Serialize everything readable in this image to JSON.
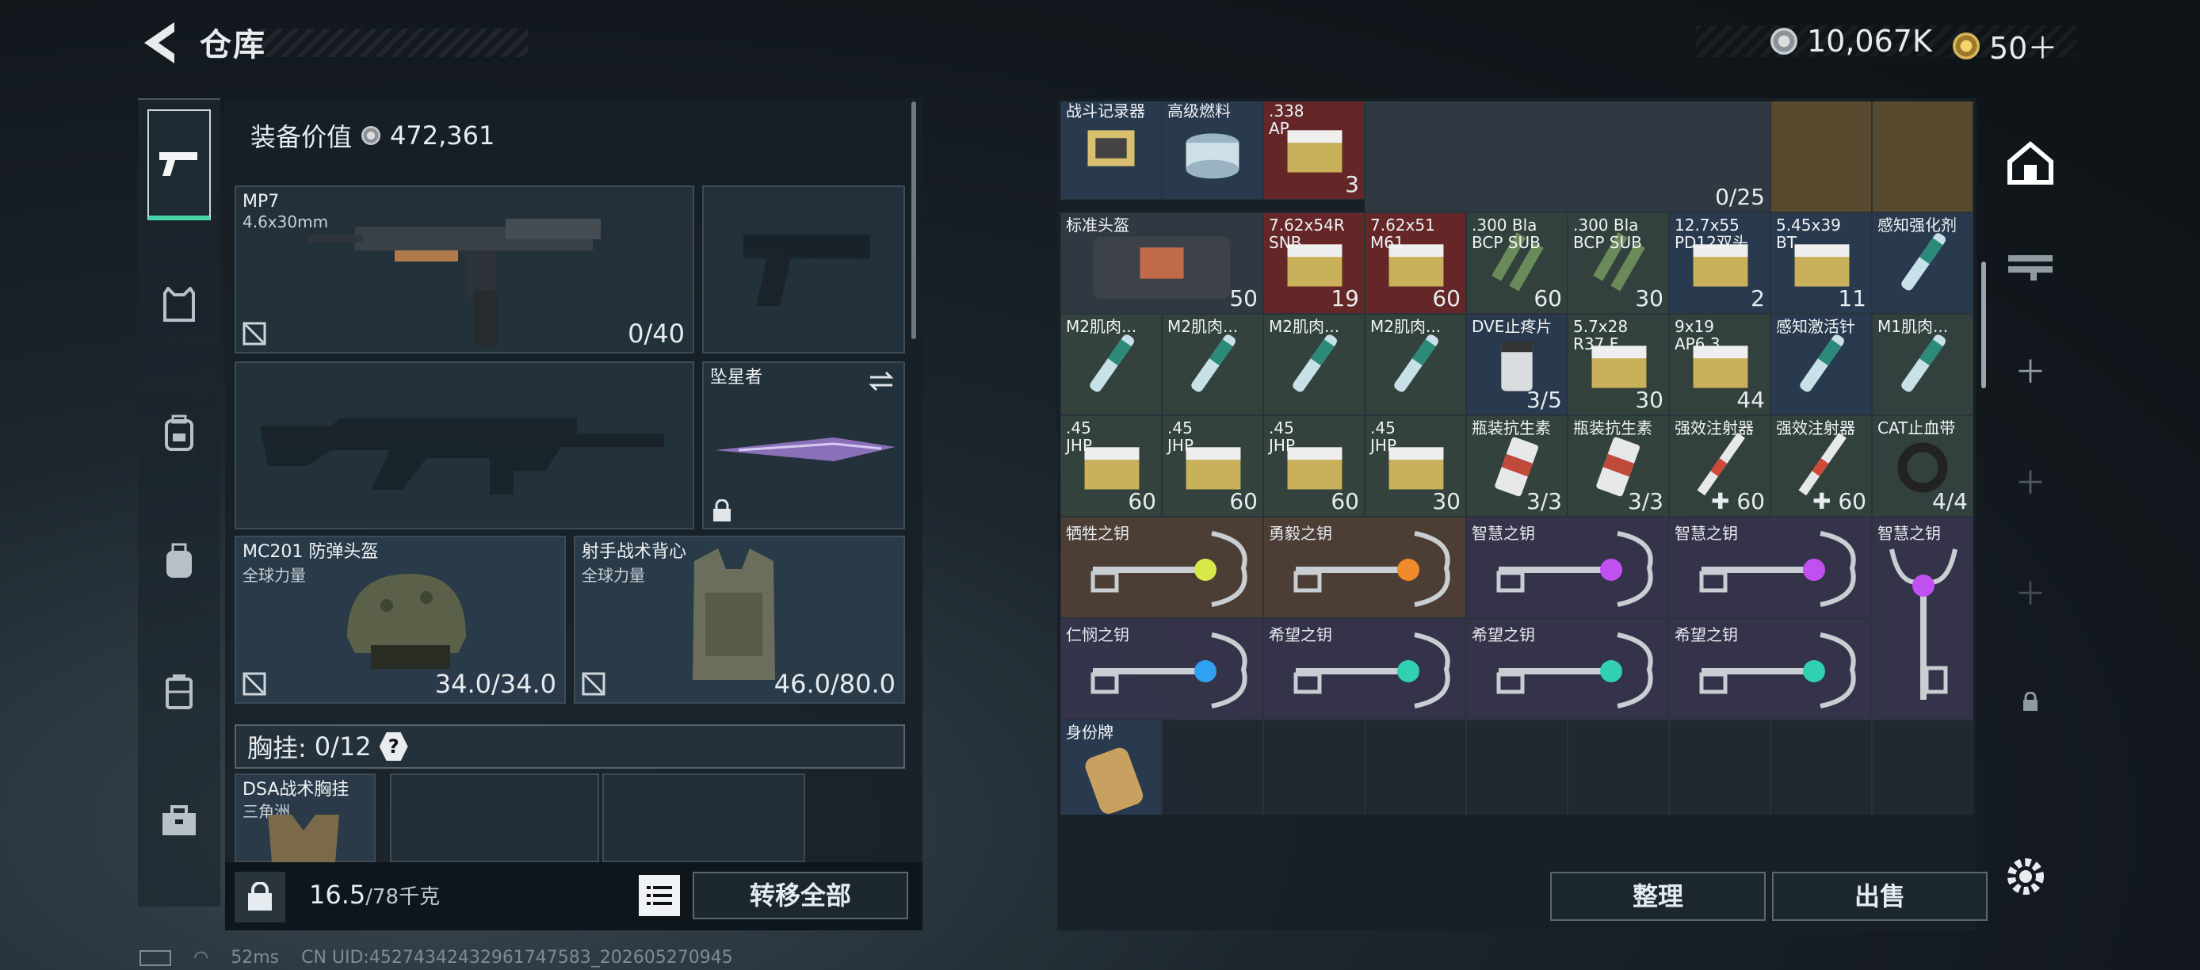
{
  "header": {
    "title": "仓库",
    "currency_main": "10,067K",
    "currency_secondary": "50＋"
  },
  "left": {
    "equip_value_label": "装备价值",
    "equip_value": "472,361",
    "primary": {
      "name": "MP7",
      "caliber": "4.6x30mm",
      "ammo": "0/40"
    },
    "melee": {
      "name": "坠星者"
    },
    "helmet": {
      "name": "MC201 防弹头盔",
      "sub": "全球力量",
      "durability": "34.0/34.0"
    },
    "vest": {
      "name": "射手战术背心",
      "sub": "全球力量",
      "durability": "46.0/80.0"
    },
    "chest_rig_label": "胸挂:",
    "chest_rig_count": "0/12",
    "chest_rig_hint": "?",
    "rig_item": {
      "name": "DSA战术胸挂",
      "sub": "三角洲"
    },
    "weight": "16.5",
    "weight_max": "/78千克",
    "transfer_all": "转移全部"
  },
  "status": {
    "ping": "52ms",
    "uid": "CN UID:45274342432961747583_202605270945"
  },
  "stash": {
    "row0": [
      {
        "name": "战斗记录器",
        "count": "",
        "color": "b",
        "icon": "recorder-icon"
      },
      {
        "name": "高级燃料",
        "count": "",
        "color": "b",
        "icon": "fuel-can-icon"
      },
      {
        "name": ".338\nAP",
        "count": "3",
        "color": "r",
        "icon": "ammo-box-icon"
      }
    ],
    "row0_counter": "0/25",
    "row1": [
      {
        "name": "标准头盔",
        "count": "50",
        "color": "",
        "icon": "helmet-bag-icon",
        "wide": true
      },
      {
        "name": "7.62x54R\nSNB",
        "count": "19",
        "color": "r",
        "icon": "ammo-box-icon"
      },
      {
        "name": "7.62x51\nM61",
        "count": "60",
        "color": "r",
        "icon": "ammo-box-icon"
      },
      {
        "name": ".300 Bla\nBCP SUB",
        "count": "60",
        "color": "g",
        "icon": "cartridge-icon"
      },
      {
        "name": ".300 Bla\nBCP SUB",
        "count": "30",
        "color": "g",
        "icon": "cartridge-icon"
      },
      {
        "name": "12.7x55\nPD12双头",
        "count": "2",
        "color": "b",
        "icon": "ammo-box-icon"
      },
      {
        "name": "5.45x39\nBT",
        "count": "11",
        "color": "b",
        "icon": "ammo-box-icon"
      },
      {
        "name": "感知强化剂",
        "count": "",
        "color": "b",
        "icon": "injector-icon"
      }
    ],
    "row2": [
      {
        "name": "M2肌肉...",
        "count": "",
        "color": "g",
        "icon": "injector-icon"
      },
      {
        "name": "M2肌肉...",
        "count": "",
        "color": "g",
        "icon": "injector-icon"
      },
      {
        "name": "M2肌肉...",
        "count": "",
        "color": "g",
        "icon": "injector-icon"
      },
      {
        "name": "M2肌肉...",
        "count": "",
        "color": "g",
        "icon": "injector-icon"
      },
      {
        "name": "DVE止疼片",
        "count": "3/5",
        "color": "b",
        "icon": "pill-bottle-icon"
      },
      {
        "name": "5.7x28\nR37.F",
        "count": "30",
        "color": "g",
        "icon": "ammo-box-icon"
      },
      {
        "name": "9x19\nAP6.3",
        "count": "44",
        "color": "g",
        "icon": "ammo-box-icon"
      },
      {
        "name": "感知激活针",
        "count": "",
        "color": "b",
        "icon": "injector-icon"
      },
      {
        "name": "M1肌肉...",
        "count": "",
        "color": "g",
        "icon": "injector-icon"
      }
    ],
    "row3": [
      {
        "name": ".45\nJHP",
        "count": "60",
        "color": "g",
        "icon": "ammo-box-icon"
      },
      {
        "name": ".45\nJHP",
        "count": "60",
        "color": "g",
        "icon": "ammo-box-icon"
      },
      {
        "name": ".45\nJHP",
        "count": "60",
        "color": "g",
        "icon": "ammo-box-icon"
      },
      {
        "name": ".45\nJHP",
        "count": "30",
        "color": "g",
        "icon": "ammo-box-icon"
      },
      {
        "name": "瓶装抗生素",
        "count": "3/3",
        "color": "g",
        "icon": "antibiotic-bottle-icon"
      },
      {
        "name": "瓶装抗生素",
        "count": "3/3",
        "color": "g",
        "icon": "antibiotic-bottle-icon"
      },
      {
        "name": "强效注射器",
        "count": "✚ 60",
        "color": "g",
        "icon": "syringe-icon"
      },
      {
        "name": "强效注射器",
        "count": "✚ 60",
        "color": "g",
        "icon": "syringe-icon"
      },
      {
        "name": "CAT止血带",
        "count": "4/4",
        "color": "g",
        "icon": "tourniquet-icon"
      }
    ],
    "keys_row4": [
      {
        "name": "牺牲之钥",
        "gem": "#d8e84a",
        "color": "brn"
      },
      {
        "name": "勇毅之钥",
        "gem": "#f08a2a",
        "color": "brn"
      },
      {
        "name": "智慧之钥",
        "gem": "#c050f0",
        "color": "pur"
      },
      {
        "name": "智慧之钥",
        "gem": "#c050f0",
        "color": "pur"
      }
    ],
    "keys_row5": [
      {
        "name": "仁悯之钥",
        "gem": "#30a0f0",
        "color": "pur"
      },
      {
        "name": "希望之钥",
        "gem": "#30d0b0",
        "color": "pur"
      },
      {
        "name": "希望之钥",
        "gem": "#30d0b0",
        "color": "pur"
      },
      {
        "name": "希望之钥",
        "gem": "#30d0b0",
        "color": "pur"
      }
    ],
    "key_vertical": {
      "name": "智慧之钥",
      "gem": "#c050f0"
    },
    "row6": [
      {
        "name": "身份牌",
        "count": "",
        "color": "b",
        "icon": "dog-tag-icon"
      }
    ],
    "sort": "整理",
    "sell": "出售"
  }
}
